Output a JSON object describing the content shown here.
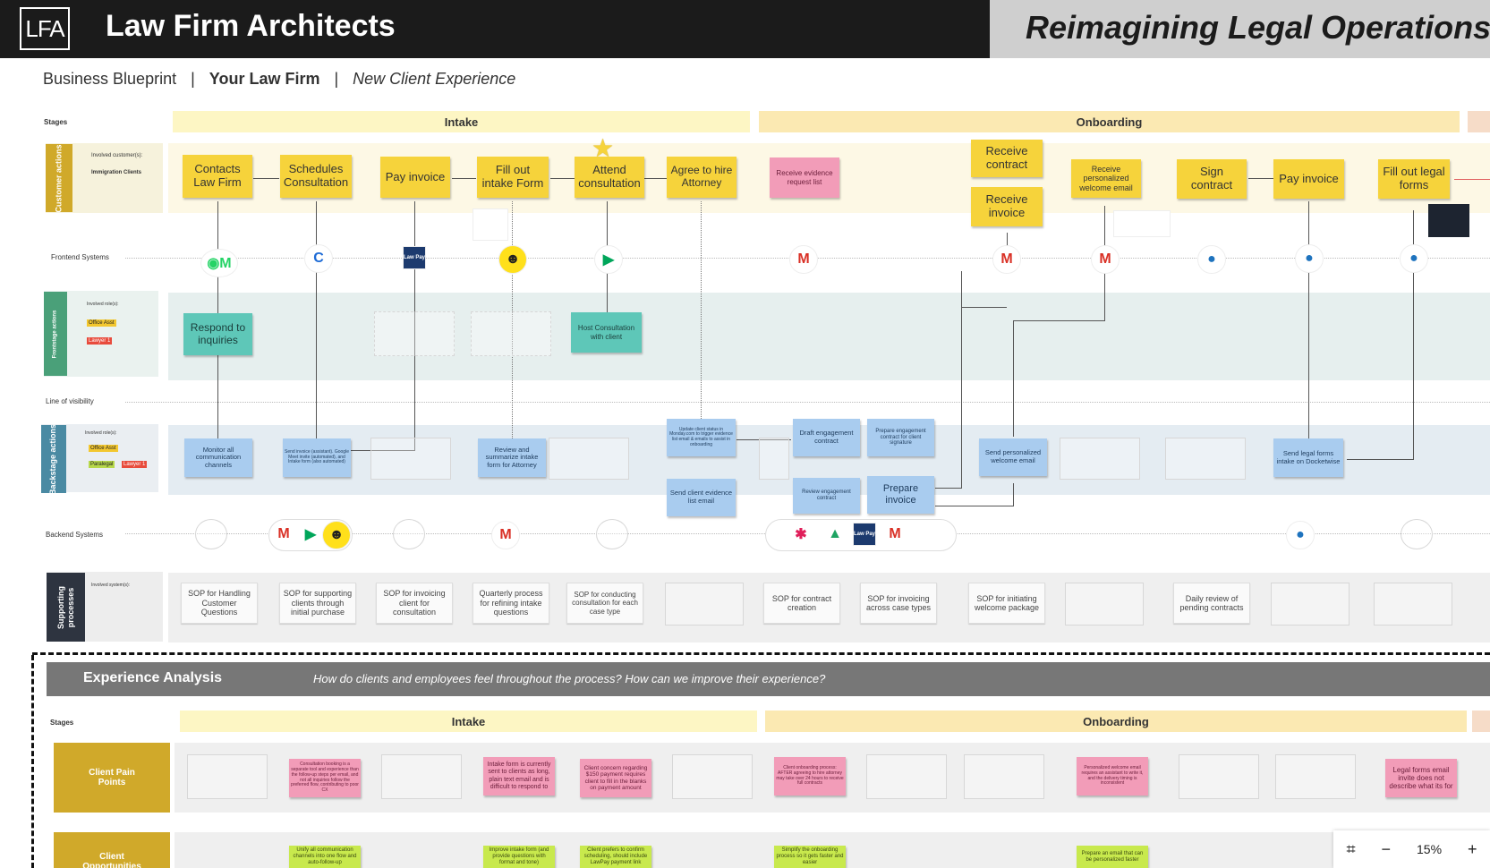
{
  "header": {
    "logo": "LFA",
    "firm_name": "Law Firm Architects",
    "tagline": "Reimagining Legal Operations"
  },
  "breadcrumb": {
    "part1": "Business Blueprint",
    "sep": "|",
    "part2": "Your Law Firm",
    "part3": "New Client Experience"
  },
  "blueprint": {
    "stages_label": "Stages",
    "stages": [
      "Intake",
      "Onboarding"
    ],
    "rows": {
      "customer_actions": "Customer actions",
      "frontstage_actions": "Frontstage actions",
      "backstage_actions": "Backstage actions",
      "supporting_processes": "Supporting processes",
      "frontend_systems": "Frontend Systems",
      "line_of_visibility": "Line of visibility",
      "backend_systems": "Backend Systems"
    },
    "involved_customers_label": "Involved customer(s):",
    "involved_customers_value": "Immigration Clients",
    "involved_roles_label": "Involved role(s):",
    "involved_systems_label": "Involved system(s):",
    "role_tags": {
      "office_asst": "Office Asst",
      "lawyer": "Lawyer 1",
      "paralegal": "Paralegal"
    },
    "customer_actions": [
      "Contacts Law Firm",
      "Schedules Consultation",
      "Pay invoice",
      "Fill out intake Form",
      "Attend consultation",
      "Agree to hire Attorney",
      "Receive evidence request list",
      "Receive contract",
      "Receive invoice",
      "Receive personalized welcome email",
      "Sign contract",
      "Pay invoice",
      "Fill out legal forms"
    ],
    "frontstage_actions": [
      "Respond to inquiries",
      "Host Consultation with client"
    ],
    "backstage_actions": [
      "Monitor all communication channels",
      "Send invoice (assistant). Google Meet invite (automated), and Intake form (also automated)",
      "Review and summarize intake form for Attorney",
      "Update client status in Monday.com to trigger evidence list email & emails to assist in onboarding",
      "Send client evidence list email",
      "Draft engagement contract",
      "Prepare engagement contract for client signature",
      "Review engagement contract",
      "Prepare invoice",
      "Send personalized welcome email",
      "Send legal forms intake on Docketwise"
    ],
    "supporting_processes": [
      "SOP for Handling Customer Questions",
      "SOP for supporting clients through initial purchase",
      "SOP for invoicing client for consultation",
      "Quarterly process for refining intake questions",
      "SOP for conducting consultation for each case type",
      "SOP for contract creation",
      "SOP for invoicing across case types",
      "SOP for initiating welcome package",
      "Daily review of pending contracts"
    ],
    "frontend_icons": [
      "whatsapp-gmail-icon",
      "calendly-icon",
      "lawpay-icon",
      "mailchimp-icon",
      "google-meet-icon",
      "gmail-icon",
      "gmail-icon",
      "gmail-icon",
      "globe-icon",
      "globe-icon",
      "globe-icon"
    ],
    "frontend_icon_text": {
      "whatsapp_gmail": "◉M",
      "calendly": "C",
      "lawpay": "Law Pay",
      "mailchimp": "☻",
      "meet": "▶",
      "gmail": "M",
      "globe": "●"
    },
    "backend_icons": [
      "gmail-icon",
      "google-meet-icon",
      "mailchimp-icon",
      "gmail-icon",
      "slack-icon",
      "google-drive-icon",
      "lawpay-icon",
      "gmail-icon",
      "globe-icon"
    ],
    "backend_icon_text": {
      "gmail": "M",
      "meet": "▶",
      "mailchimp": "☻",
      "slack": "✱",
      "drive": "▲",
      "lawpay": "Law Pay",
      "globe": "●"
    }
  },
  "experience": {
    "title": "Experience Analysis",
    "question": "How do clients and employees feel throughout the process? How can we improve their experience?",
    "stages_label": "Stages",
    "stages": [
      "Intake",
      "Onboarding"
    ],
    "row_pain": "Client Pain Points",
    "row_opps": "Client Opportunities to",
    "pain_points": [
      "Consultation booking is a separate tool and experience than the follow-up steps per email, and not all inquiries follow the preferred flow, contributing to poor CX",
      "Intake form is currently sent to clients as long, plain text email and is difficult to respond to",
      "Client concern regarding $150 payment requires client to fill in the blanks on payment amount",
      "Client onboarding process: AFTER agreeing to hire attorney may take over 24 hours to receive full contracts",
      "Personalized welcome email requires an assistant to write it, and the delivery timing is inconsistent",
      "Legal forms email invite does not describe what its for"
    ],
    "opportunities": [
      "Unify all communication channels into one flow and auto-follow-up",
      "Improve intake form (and provide questions with format and tone)",
      "Client prefers to confirm scheduling, should include LawPay payment link",
      "Simplify the onboarding process so it gets faster and easier",
      "Prepare an email that can be personalized faster"
    ]
  },
  "zoom": {
    "level": "15%",
    "fit_icon": "⌗",
    "minus": "−",
    "plus": "+"
  }
}
